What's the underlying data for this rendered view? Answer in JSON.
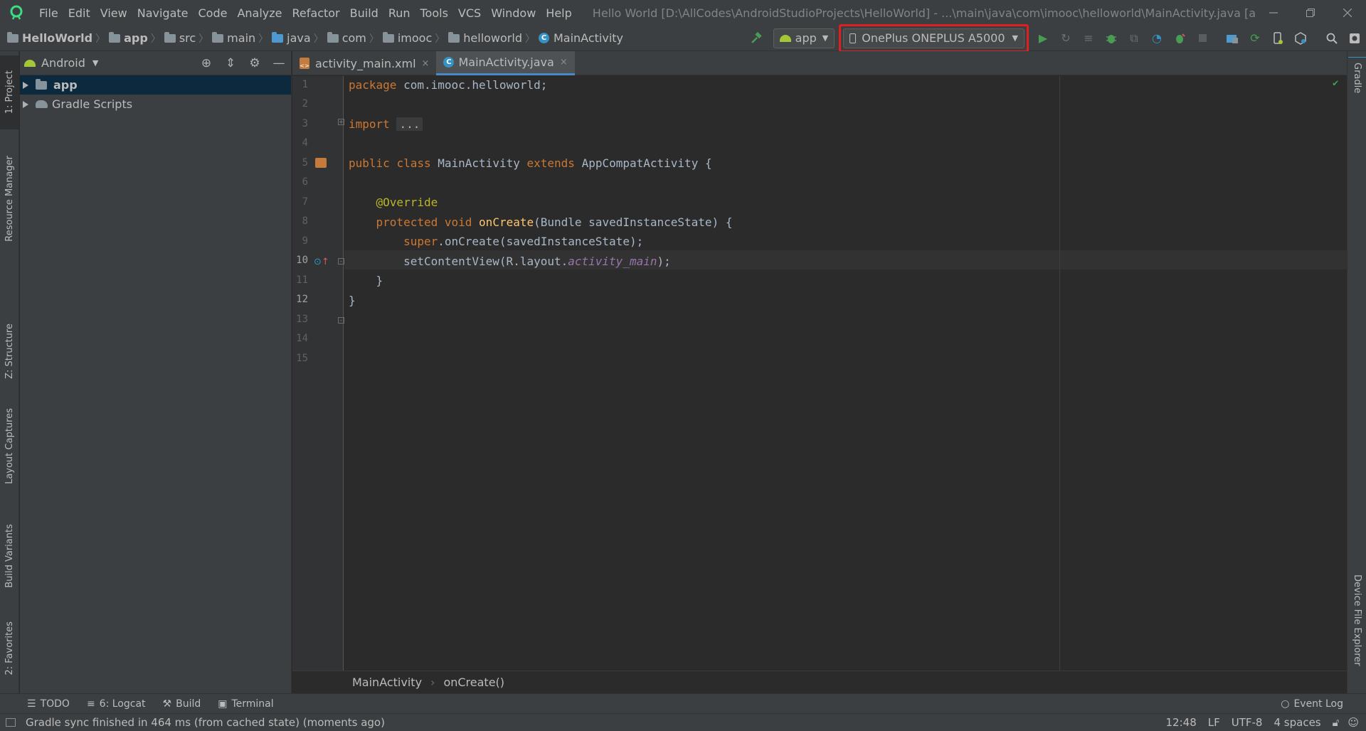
{
  "menu": {
    "items": [
      "File",
      "Edit",
      "View",
      "Navigate",
      "Code",
      "Analyze",
      "Refactor",
      "Build",
      "Run",
      "Tools",
      "VCS",
      "Window",
      "Help"
    ],
    "window_title": "Hello World [D:\\AllCodes\\AndroidStudioProjects\\HelloWorld] - ...\\main\\java\\com\\imooc\\helloworld\\MainActivity.java [app]"
  },
  "breadcrumb": [
    "HelloWorld",
    "app",
    "src",
    "main",
    "java",
    "com",
    "imooc",
    "helloworld",
    "MainActivity"
  ],
  "toolbar": {
    "run_config": "app",
    "device": "OnePlus ONEPLUS A5000"
  },
  "project_panel": {
    "view_selector": "Android",
    "tree": [
      "app",
      "Gradle Scripts"
    ]
  },
  "editor_tabs": [
    {
      "label": "activity_main.xml",
      "close": "×"
    },
    {
      "label": "MainActivity.java",
      "close": "×"
    }
  ],
  "code": {
    "line_numbers": [
      "1",
      "2",
      "3",
      "4",
      "5",
      "6",
      "7",
      "8",
      "9",
      "10",
      "11",
      "12",
      "13",
      "14",
      "15"
    ],
    "current_line": "12",
    "package_kw": "package",
    "package_name": " com.imooc.helloworld;",
    "import_kw": "import",
    "import_fold": "...",
    "public_kw": "public",
    "class_kw": "class",
    "class_name": "MainActivity",
    "extends_kw": "extends",
    "super_class": "AppCompatActivity {",
    "annotation": "@Override",
    "protected_kw": "protected",
    "void_kw": "void",
    "method_name": "onCreate",
    "method_params": "(Bundle savedInstanceState) {",
    "super_kw": "super",
    "super_call": ".onCreate(savedInstanceState);",
    "set_content": "setContentView(R.layout.",
    "layout_field": "activity_main",
    "set_content_end": ");",
    "close_method": "}",
    "close_class": "}"
  },
  "editor_breadcrumb": [
    "MainActivity",
    "onCreate()"
  ],
  "left_tabs": [
    "1: Project",
    "Resource Manager",
    "Z: Structure",
    "Layout Captures",
    "Build Variants",
    "2: Favorites"
  ],
  "right_tabs": [
    "Gradle",
    "Device File Explorer"
  ],
  "bottom_tabs": [
    "TODO",
    "6: Logcat",
    "Build",
    "Terminal"
  ],
  "event_log": "Event Log",
  "status": {
    "message": "Gradle sync finished in 464 ms (from cached state) (moments ago)",
    "position": "12:48",
    "line_sep": "LF",
    "encoding": "UTF-8",
    "indent": "4 spaces"
  },
  "colors": {
    "highlight_box": "#e02020",
    "run_green": "#499c54",
    "android_green": "#a4c639"
  }
}
